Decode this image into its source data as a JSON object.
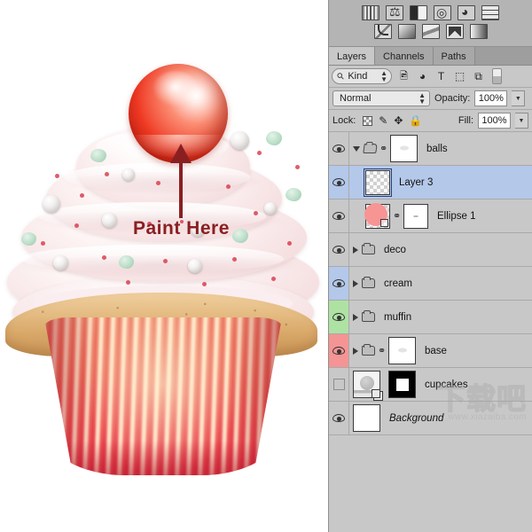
{
  "canvas": {
    "annotation": {
      "label": "Paint Here",
      "arrow_color": "#8a1f22"
    },
    "artwork_name": "cupcake-illustration"
  },
  "panel": {
    "adjustments": {
      "row1": [
        {
          "name": "histogram-icon",
          "glyph": ""
        },
        {
          "name": "color-balance-icon",
          "glyph": ""
        },
        {
          "name": "black-white-icon",
          "glyph": ""
        },
        {
          "name": "exposure-icon",
          "glyph": ""
        },
        {
          "name": "vibrance-icon",
          "glyph": ""
        },
        {
          "name": "pattern-grid-icon",
          "glyph": ""
        }
      ],
      "row2": [
        {
          "name": "curves-icon",
          "glyph": ""
        },
        {
          "name": "gradient-map-icon",
          "glyph": ""
        },
        {
          "name": "selective-color-icon",
          "glyph": ""
        },
        {
          "name": "invert-icon",
          "glyph": ""
        },
        {
          "name": "gradient-fill-icon",
          "glyph": ""
        }
      ]
    },
    "tabs": [
      {
        "label": "Layers",
        "active": true
      },
      {
        "label": "Channels",
        "active": false
      },
      {
        "label": "Paths",
        "active": false
      }
    ],
    "filter": {
      "kind_label": "Kind",
      "search_icon": "search-icon",
      "icons": [
        {
          "name": "filter-pixel-layers-icon",
          "glyph": "⛰"
        },
        {
          "name": "filter-adjustment-layers-icon",
          "glyph": "◑"
        },
        {
          "name": "filter-type-layers-icon",
          "glyph": "T"
        },
        {
          "name": "filter-shape-layers-icon",
          "glyph": "⬚"
        },
        {
          "name": "filter-smart-objects-icon",
          "glyph": "⧉"
        }
      ],
      "toggle_name": "filter-enable-toggle"
    },
    "blend": {
      "mode": "Normal",
      "opacity_label": "Opacity:",
      "opacity_value": "100%",
      "fill_label": "Fill:",
      "fill_value": "100%"
    },
    "lock": {
      "label": "Lock:",
      "items": [
        {
          "name": "lock-transparent-pixels-icon",
          "glyph": ""
        },
        {
          "name": "lock-image-pixels-icon",
          "glyph": "✎"
        },
        {
          "name": "lock-position-icon",
          "glyph": "✥"
        },
        {
          "name": "lock-all-icon",
          "glyph": "🔒"
        }
      ]
    },
    "layers": [
      {
        "name": "balls",
        "visible": true,
        "selected": false,
        "tag": "none",
        "indent": false,
        "type": "group",
        "expanded": true,
        "linked": true,
        "thumb": "mask-white",
        "italic": false
      },
      {
        "name": "Layer 3",
        "visible": true,
        "selected": true,
        "tag": "none",
        "indent": true,
        "type": "pixel",
        "expanded": false,
        "linked": false,
        "thumb": "checker",
        "italic": false
      },
      {
        "name": "Ellipse 1",
        "visible": true,
        "selected": false,
        "tag": "none",
        "indent": true,
        "type": "shape",
        "expanded": false,
        "linked": true,
        "thumb": "pink",
        "italic": false
      },
      {
        "name": "deco",
        "visible": true,
        "selected": false,
        "tag": "none",
        "indent": false,
        "type": "group",
        "expanded": false,
        "linked": false,
        "thumb": "none",
        "italic": false
      },
      {
        "name": "cream",
        "visible": true,
        "selected": false,
        "tag": "blue",
        "indent": false,
        "type": "group",
        "expanded": false,
        "linked": false,
        "thumb": "none",
        "italic": false
      },
      {
        "name": "muffin",
        "visible": true,
        "selected": false,
        "tag": "green",
        "indent": false,
        "type": "group",
        "expanded": false,
        "linked": false,
        "thumb": "none",
        "italic": false
      },
      {
        "name": "base",
        "visible": true,
        "selected": false,
        "tag": "red",
        "indent": false,
        "type": "group",
        "expanded": false,
        "linked": true,
        "thumb": "mask-white",
        "italic": false
      },
      {
        "name": "cupcakes",
        "visible": false,
        "selected": false,
        "tag": "none",
        "indent": false,
        "type": "smart",
        "expanded": false,
        "linked": false,
        "thumb": "smart",
        "italic": false
      },
      {
        "name": "Background",
        "visible": true,
        "selected": false,
        "tag": "none",
        "indent": false,
        "type": "background",
        "expanded": false,
        "linked": false,
        "thumb": "white",
        "italic": true
      }
    ]
  },
  "watermark": {
    "brand": "下载吧",
    "url": "www.xiazaiba.com"
  }
}
